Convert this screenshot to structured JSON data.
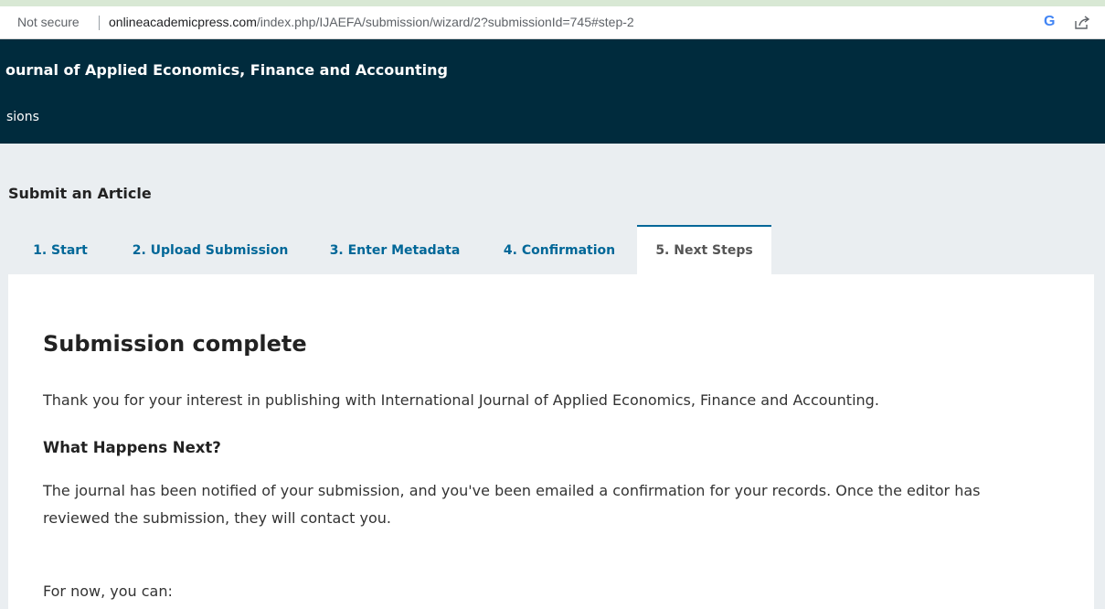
{
  "browser": {
    "security_label": "Not secure",
    "url_host": "onlineacademicpress.com",
    "url_path": "/index.php/IJAEFA/submission/wizard/2?submissionId=745#step-2",
    "google_icon_glyph": "G",
    "icons": [
      "google-icon",
      "share-icon"
    ]
  },
  "header": {
    "journal_title": "ournal of Applied Economics, Finance and Accounting",
    "nav_item": "sions",
    "background_color": "#002b3d"
  },
  "page": {
    "heading": "Submit an Article"
  },
  "tabs": [
    {
      "label": "1. Start",
      "active": false
    },
    {
      "label": "2. Upload Submission",
      "active": false
    },
    {
      "label": "3. Enter Metadata",
      "active": false
    },
    {
      "label": "4. Confirmation",
      "active": false
    },
    {
      "label": "5. Next Steps",
      "active": true
    }
  ],
  "content": {
    "title": "Submission complete",
    "thank_you": "Thank you for your interest in publishing with International Journal of Applied Economics, Finance and Accounting.",
    "next_heading": "What Happens Next?",
    "next_body": "The journal has been notified of your submission, and you've been emailed a confirmation for your records. Once the editor has reviewed the submission, they will contact you.",
    "for_now": "For now, you can:"
  },
  "colors": {
    "accent": "#006798",
    "page_background": "#eaeef1"
  }
}
